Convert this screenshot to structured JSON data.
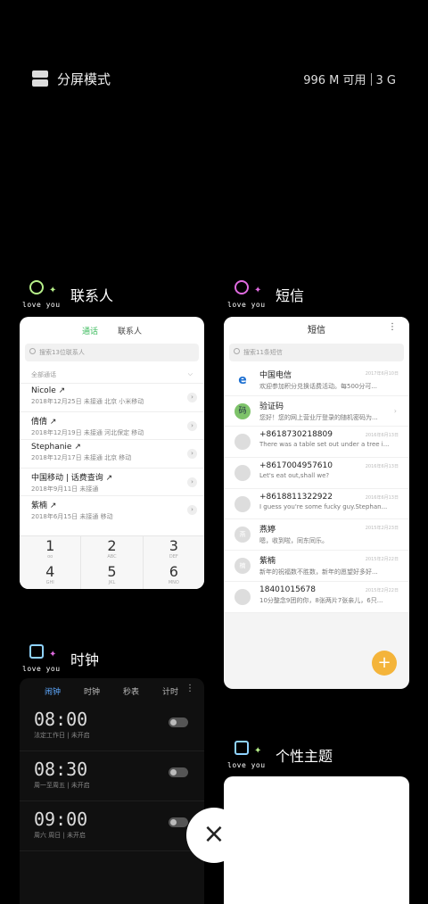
{
  "topbar": {
    "split_label": "分屏模式",
    "memory": "996 M 可用",
    "ram": "3 G"
  },
  "apps": {
    "contacts_title": "联系人",
    "sms_title": "短信",
    "clock_title": "时钟",
    "theme_title": "个性主题",
    "love_text": "love you"
  },
  "contacts": {
    "tabs": [
      "通话",
      "联系人"
    ],
    "search_placeholder": "搜索13位联系人",
    "group": "全部通话",
    "rows": [
      {
        "name": "Nicole ↗",
        "sub": "2018年12月25日 未接通  北京 小米移动"
      },
      {
        "name": "倩倩 ↗",
        "sub": "2018年12月19日 未接通  河北保定 移动"
      },
      {
        "name": "Stephanie ↗",
        "sub": "2018年12月17日 未接通  北京 移动"
      },
      {
        "name": "中国移动 | 话费查询 ↗",
        "sub": "2018年9月11日 未接通"
      },
      {
        "name": "紫楠 ↗",
        "sub": "2018年6月15日 未接通  移动"
      }
    ],
    "keys": [
      {
        "n": "1",
        "l": "oo"
      },
      {
        "n": "2",
        "l": "ABC"
      },
      {
        "n": "3",
        "l": "DEF"
      },
      {
        "n": "4",
        "l": "GHI"
      },
      {
        "n": "5",
        "l": "JKL"
      },
      {
        "n": "6",
        "l": "MNO"
      }
    ]
  },
  "sms": {
    "title": "短信",
    "search_placeholder": "搜索11条短信",
    "rows": [
      {
        "name": "中国电信",
        "msg": "欢迎参加积分兑换话费活动。每500分可...",
        "date": "2017年6月10日",
        "avatar": "e"
      },
      {
        "name": "验证码",
        "msg": "您好！您的网上营业厅登录的随机密码为...",
        "date": "",
        "avatar": "码"
      },
      {
        "name": "+8618730218809",
        "msg": "There was a table set out under a tree i...",
        "date": "2016年6月13日",
        "avatar": ""
      },
      {
        "name": "+8617004957610",
        "msg": "Let's eat out,shall we?",
        "date": "2016年6月13日",
        "avatar": ""
      },
      {
        "name": "+8618811322922",
        "msg": "I guess you're some fucky guy.Stephan...",
        "date": "2016年6月13日",
        "avatar": ""
      },
      {
        "name": "燕婷",
        "msg": "嗯，收到啦，同东同乐。",
        "date": "2015年2月23日",
        "avatar": "燕"
      },
      {
        "name": "紫楠",
        "msg": "新年的祝福数不胜数，新年的愿望好多好...",
        "date": "2015年2月22日",
        "avatar": "楠"
      },
      {
        "name": "18401015678",
        "msg": "10分整念9团的你，8张两片7张亲儿，6只...",
        "date": "2015年2月22日",
        "avatar": ""
      }
    ],
    "fab": "+"
  },
  "clock": {
    "tabs": [
      "闹钟",
      "时钟",
      "秒表",
      "计时"
    ],
    "alarms": [
      {
        "time": "08:00",
        "sub": "法定工作日 | 未开启"
      },
      {
        "time": "08:30",
        "sub": "周一至周五 | 未开启"
      },
      {
        "time": "09:00",
        "sub": "周六 周日 | 未开启"
      }
    ]
  },
  "close_symbol": "×"
}
